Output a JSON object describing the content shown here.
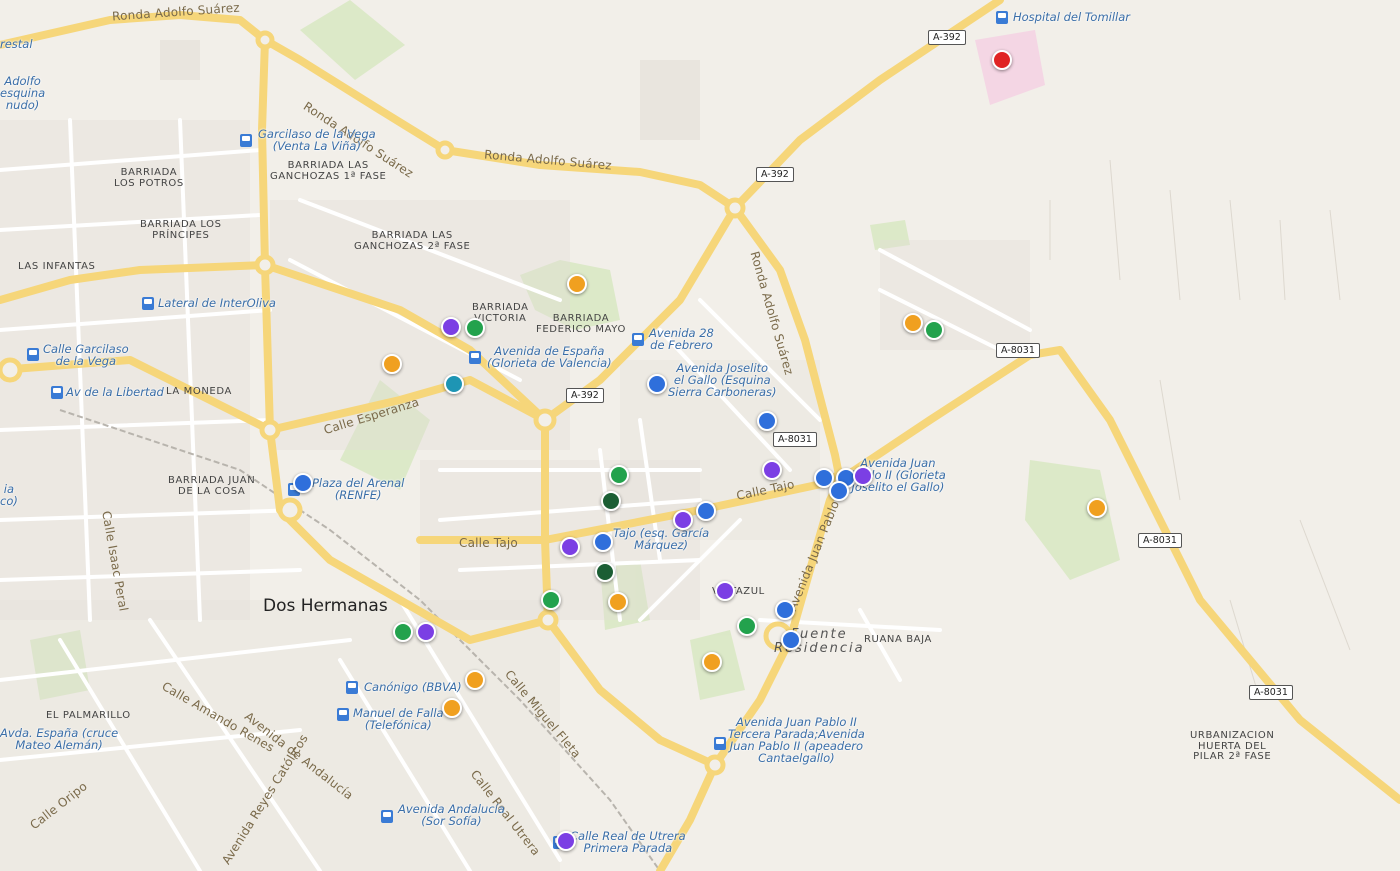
{
  "map": {
    "city": "Dos Hermanas",
    "streets": {
      "ronda_top": "Ronda Adolfo Suárez",
      "ronda_diag": "Ronda Adolfo Suárez",
      "ronda_mid": "Ronda Adolfo Suárez",
      "ronda_vert": "Ronda Adolfo Suárez",
      "calle_esperanza": "Calle Esperanza",
      "calle_tajo_w": "Calle Tajo",
      "calle_tajo_e": "Calle Tajo",
      "isaac_peral": "Calle Isaac Peral",
      "amador": "Calle Amando Renes",
      "andalucia": "Avenida de Andalucía",
      "reyes": "Avenida Reyes Católicos",
      "miguel_fleta": "Calle Miguel Fleta",
      "real_utrera": "Calle Real Utrera",
      "juan_pablo": "Avenida Juan Pablo II",
      "oripo": "Calle Oripo"
    },
    "road_shields": {
      "a392_top": "A-392",
      "a392_mid": "A-392",
      "a392_low": "A-392",
      "a8031_a": "A-8031",
      "a8031_b": "A-8031",
      "a8031_c": "A-8031",
      "a8031_d": "A-8031"
    },
    "districts": {
      "potros": "BARRIADA\nLOS POTROS",
      "ganchozas1": "BARRIADA LAS\nGANCHOZAS 1ª FASE",
      "ganchozas2": "BARRIADA LAS\nGANCHOZAS 2ª FASE",
      "principes": "BARRIADA LOS\nPRÍNCIPES",
      "infantas": "LAS INFANTAS",
      "victoria": "BARRIADA\nVICTORIA",
      "federico": "BARRIADA\nFEDERICO MAYO",
      "moneda": "LA MONEDA",
      "juan_cosa": "BARRIADA JUAN\nDE LA COSA",
      "palmarillo": "EL PALMARILLO",
      "ruana": "RUANA BAJA",
      "huerta": "URBANIZACION\nHUERTA DEL\nPILAR 2ª FASE",
      "vistazul": "VISTAZUL",
      "fuente": "Fuente\nResidencia"
    },
    "stops": {
      "hospital": "Hospital del Tomillar",
      "garcilaso_venta": "Garcilaso de la Vega\n(Venta La Viña)",
      "interoliva": "Lateral de InterOliva",
      "garcilaso": "Calle Garcilaso\nde la Vega",
      "libertad": "Av de la Libertad",
      "avenida_espana": "Avenida de España\n(Glorieta de Valencia)",
      "avenida28": "Avenida 28\nde Febrero",
      "joselito": "Avenida Joselito\nel Gallo (Esquina\nSierra Carboneras)",
      "plaza_arenal": "Plaza del Arenal\n(RENFE)",
      "juan_pablo_glorieta": "Avenida Juan\nPablo II (Glorieta\nJoselito el Gallo)",
      "tajo_garcia": "Tajo (esq. García\nMárquez)",
      "canonigo": "Canónigo (BBVA)",
      "manuel_falla": "Manuel de Falla\n(Telefónica)",
      "juan_pablo_tercera": "Avenida Juan Pablo II\nTercera Parada;Avenida\nJuan Pablo II (apeadero\nCantaelgallo)",
      "andalucia_sor": "Avenida Andalucía\n(Sor Sofía)",
      "real_utrera": "Calle Real de Utrera\nPrimera Parada",
      "espana_cruce": "Avda. España (cruce\nMateo Alemán)",
      "adolfo_esquina": "Adolfo\nesquina\nnudo)",
      "restal": "restal",
      "ia": "ia\nco)"
    },
    "colors": {
      "blue": "#2f6fdb",
      "purple": "#7b3fe4",
      "green": "#23a24d",
      "dark_green": "#1b5e34",
      "orange": "#f0a020",
      "teal": "#1e95b4",
      "red": "#e02424"
    },
    "marker_icon": "map-pin-dot",
    "bus_icon": "bus-stop-icon"
  }
}
